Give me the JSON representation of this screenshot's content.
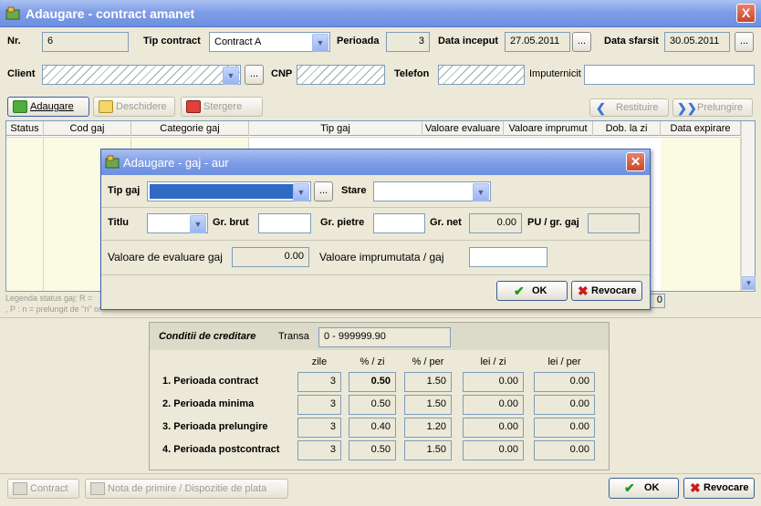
{
  "window": {
    "title": "Adaugare - contract amanet",
    "close": "X"
  },
  "header": {
    "nr_label": "Nr.",
    "nr_value": "6",
    "tip_label": "Tip contract",
    "tip_value": "Contract A",
    "perioada_label": "Perioada",
    "perioada_value": "3",
    "data_inceput_label": "Data inceput",
    "data_inceput_value": "27.05.2011",
    "data_sfarsit_label": "Data sfarsit",
    "data_sfarsit_value": "30.05.2011",
    "ellipsis": "...",
    "client_label": "Client",
    "cnp_label": "CNP",
    "telefon_label": "Telefon",
    "imputernicit_label": "Imputernicit"
  },
  "toolbar": {
    "adaugare": "Adaugare",
    "deschidere": "Deschidere",
    "stergere": "Stergere",
    "restituire": "Restituire",
    "prelungire": "Prelungire"
  },
  "grid": {
    "columns": [
      "Status",
      "Cod gaj",
      "Categorie gaj",
      "Tip gaj",
      "Valoare evaluare",
      "Valoare imprumut",
      "Dob. la zi",
      "Data expirare"
    ],
    "legend_line1": "Legenda status gaj: R =",
    "legend_line2": ", P : n = prelungit de \"n\" ori",
    "total_fragment": "0"
  },
  "dialog": {
    "title": "Adaugare - gaj - aur",
    "tip_gaj_label": "Tip gaj",
    "stare_label": "Stare",
    "titlu_label": "Titlu",
    "gr_brut_label": "Gr. brut",
    "gr_pietre_label": "Gr. pietre",
    "gr_net_label": "Gr. net",
    "gr_net_value": "0.00",
    "pu_label": "PU / gr. gaj",
    "valoare_evaluare_label": "Valoare de evaluare gaj",
    "valoare_evaluare_value": "0.00",
    "valoare_imprumut_label": "Valoare imprumutata / gaj",
    "ok": "OK",
    "revocare": "Revocare",
    "ellipsis": "..."
  },
  "conditii": {
    "title": "Conditii de creditare",
    "transa_label": "Transa",
    "transa_value": "0 - 999999.90",
    "headers": [
      "zile",
      "% / zi",
      "% / per",
      "lei / zi",
      "lei / per"
    ],
    "rows": [
      {
        "label": "1. Perioada contract",
        "zile": "3",
        "pzi": "0.50",
        "pper": "1.50",
        "leizi": "0.00",
        "leiper": "0.00"
      },
      {
        "label": "2. Perioada minima",
        "zile": "3",
        "pzi": "0.50",
        "pper": "1.50",
        "leizi": "0.00",
        "leiper": "0.00"
      },
      {
        "label": "3. Perioada prelungire",
        "zile": "3",
        "pzi": "0.40",
        "pper": "1.20",
        "leizi": "0.00",
        "leiper": "0.00"
      },
      {
        "label": "4. Perioada postcontract",
        "zile": "3",
        "pzi": "0.50",
        "pper": "1.50",
        "leizi": "0.00",
        "leiper": "0.00"
      }
    ]
  },
  "footer": {
    "contract": "Contract",
    "nota": "Nota de primire / Dispozitie de plata",
    "ok": "OK",
    "revocare": "Revocare"
  },
  "colors": {
    "title_blue": "#7f9ee6",
    "grid_yellow": "#fbfbe3",
    "selection_blue": "#316ac5"
  }
}
